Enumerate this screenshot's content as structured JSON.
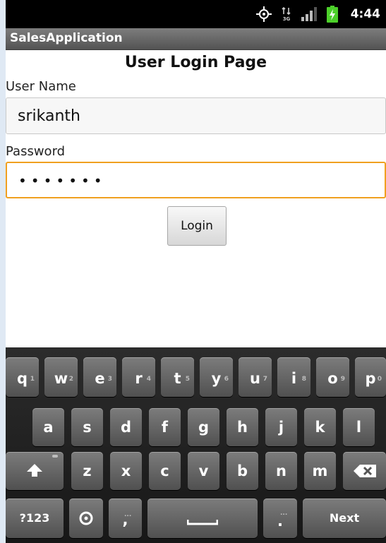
{
  "status_bar": {
    "time": "4:44",
    "icons": [
      "gps-icon",
      "network-3g-icon",
      "signal-bars-icon",
      "battery-charging-icon"
    ]
  },
  "app": {
    "title": "SalesApplication"
  },
  "form": {
    "heading": "User Login Page",
    "username_label": "User Name",
    "username_value": "srikanth",
    "password_label": "Password",
    "password_masked": "•••••••",
    "login_label": "Login"
  },
  "keyboard": {
    "row1": [
      {
        "ch": "q",
        "hint": "1"
      },
      {
        "ch": "w",
        "hint": "2"
      },
      {
        "ch": "e",
        "hint": "3"
      },
      {
        "ch": "r",
        "hint": "4"
      },
      {
        "ch": "t",
        "hint": "5"
      },
      {
        "ch": "y",
        "hint": "6"
      },
      {
        "ch": "u",
        "hint": "7"
      },
      {
        "ch": "i",
        "hint": "8"
      },
      {
        "ch": "o",
        "hint": "9"
      },
      {
        "ch": "p",
        "hint": "0"
      }
    ],
    "row2": [
      "a",
      "s",
      "d",
      "f",
      "g",
      "h",
      "j",
      "k",
      "l"
    ],
    "row3": [
      "z",
      "x",
      "c",
      "v",
      "b",
      "n",
      "m"
    ],
    "symbols_label": "?123",
    "comma_label": ",",
    "period_label": ".",
    "period_hint": "...",
    "comma_hint": "...",
    "next_label": "Next",
    "icon_names": {
      "shift": "shift-arrow-icon",
      "backspace": "backspace-icon",
      "settings": "settings-dial-icon",
      "space": "spacebar-icon"
    }
  },
  "colors": {
    "focus_border": "#f0a020",
    "status_bar": "#000000",
    "title_bar": "#6a6a6a",
    "battery": "#4cd02a"
  }
}
